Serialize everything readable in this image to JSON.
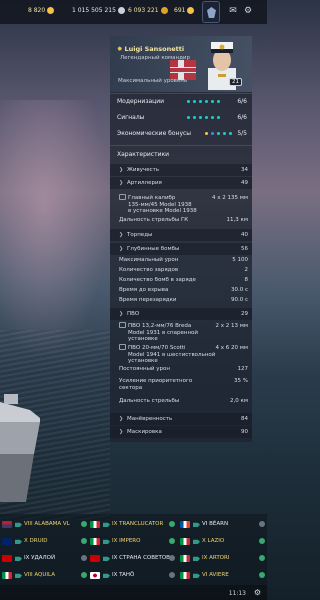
{
  "top_bar": {
    "doubloons": "8 820",
    "credits": "1 015 505 215",
    "free_xp": "6 093 221",
    "clan_points": "691",
    "colors": {
      "doubloons": "#f2c14e",
      "credits": "#d9dfe6",
      "free_xp": "#f2c14e"
    }
  },
  "commander": {
    "name": "Luigi Sansonetti",
    "rank": "Легендарный командир",
    "max_level_label": "Максимальный уровень",
    "points": "21",
    "star_icon": "star-icon"
  },
  "upgrades": [
    {
      "label": "Модернизации",
      "count": "6/6",
      "dots": [
        "t",
        "t",
        "t",
        "t",
        "t",
        "t"
      ]
    },
    {
      "label": "Сигналы",
      "count": "6/6",
      "dots": [
        "t",
        "t",
        "t",
        "t",
        "t",
        "t"
      ]
    },
    {
      "label": "Экономические бонусы",
      "count": "5/5",
      "dots": [
        "y",
        "b",
        "t",
        "t",
        "t"
      ]
    }
  ],
  "characteristics_title": "Характеристики",
  "stats": [
    {
      "type": "sec",
      "label": "Живучесть",
      "value": "34"
    },
    {
      "type": "sec",
      "label": "Артиллерия",
      "value": "49"
    },
    {
      "type": "sub",
      "label": "Главный калибр\n135-мм/45 Model 1938\nв установке Model 1938",
      "value": "4 x 2  135 мм"
    },
    {
      "type": "sub",
      "label": "Дальность стрельбы ГК",
      "value": "11,3 км"
    },
    {
      "type": "sec",
      "label": "Торпеды",
      "value": "40"
    },
    {
      "type": "sec",
      "label": "Глубинные бомбы",
      "value": "56"
    },
    {
      "type": "sub",
      "label": "Максимальный урон",
      "value": "5 100"
    },
    {
      "type": "sub",
      "label": "Количество зарядов",
      "value": "2"
    },
    {
      "type": "sub",
      "label": "Количество бомб в заряде",
      "value": "8"
    },
    {
      "type": "sub",
      "label": "Время до взрыва",
      "value": "30.0 с"
    },
    {
      "type": "sub",
      "label": "Время перезарядки",
      "value": "90.0 с"
    },
    {
      "type": "sec",
      "label": "ПВО",
      "value": "29"
    },
    {
      "type": "sub",
      "label": "ПВО 13,2-мм/76 Breda\nModel 1931 в спаренной\nустановке",
      "value": "2 x 2  13 мм"
    },
    {
      "type": "sub",
      "label": "ПВО 20-мм/70 Scotti\nModel 1941 в шестиствольной\nустановке",
      "value": "4 x 6  20 мм"
    },
    {
      "type": "sub",
      "label": "Постоянный урон",
      "value": "127"
    },
    {
      "type": "sub",
      "label": "Усиление приоритетного\nсектора",
      "value": "35 %"
    },
    {
      "type": "sub",
      "label": "Дальность стрельбы",
      "value": "2,0 км"
    },
    {
      "type": "sec",
      "label": "Манёвренность",
      "value": "84"
    },
    {
      "type": "sec",
      "label": "Маскировка",
      "value": "90"
    }
  ],
  "teams": [
    {
      "name": "VIII ALABAMA VL",
      "flag": "us",
      "gold": true
    },
    {
      "name": "IX TRANCLUCATOR",
      "flag": "it",
      "gold": true
    },
    {
      "name": "VI BÉARN",
      "flag": "fr",
      "gold": false
    },
    {
      "name": "X DRUID",
      "flag": "uk",
      "gold": true
    },
    {
      "name": "IX IMPERO",
      "flag": "it",
      "gold": true
    },
    {
      "name": "X LAZIO",
      "flag": "it",
      "gold": true
    },
    {
      "name": "IX УДАЛОЙ",
      "flag": "su",
      "gold": false
    },
    {
      "name": "IX СТРАНА СОВЕТОВ",
      "flag": "su",
      "gold": false
    },
    {
      "name": "IX ARTORI",
      "flag": "it",
      "gold": true
    },
    {
      "name": "VIII AQUILA",
      "flag": "it",
      "gold": true
    },
    {
      "name": "IX TAHÖ",
      "flag": "jp",
      "gold": false
    },
    {
      "name": "VI AVIERE",
      "flag": "it",
      "gold": true
    }
  ],
  "status": {
    "time": "11:13"
  }
}
